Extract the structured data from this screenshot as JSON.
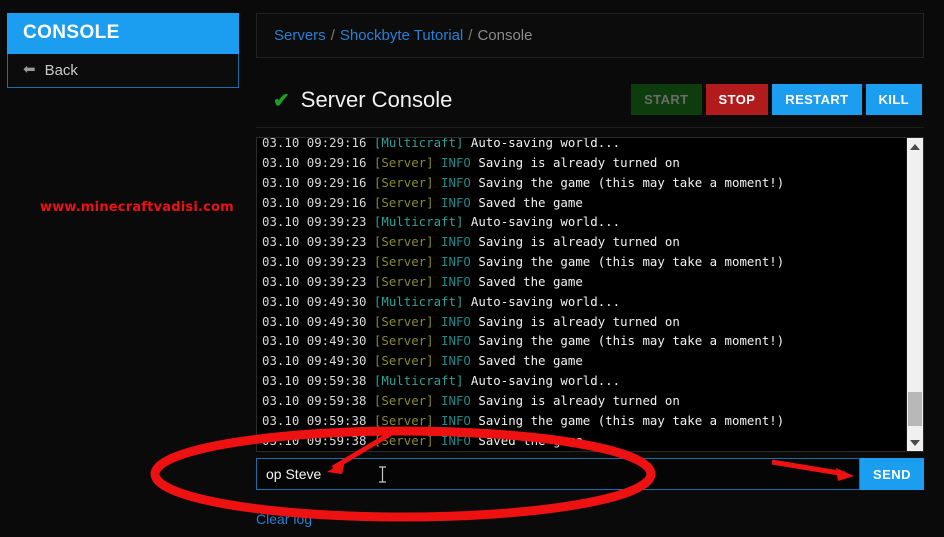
{
  "sidebar": {
    "header_label": "CONSOLE",
    "back_label": "Back",
    "back_icon": "arrow-left-icon"
  },
  "watermark": {
    "text": "www.minecraftvadisi.com",
    "color": "#ee1111"
  },
  "breadcrumb": {
    "items": [
      {
        "label": "Servers",
        "type": "link"
      },
      {
        "label": "Shockbyte Tutorial",
        "type": "link"
      },
      {
        "label": "Console",
        "type": "current"
      }
    ],
    "separator": "/"
  },
  "header": {
    "status_icon": "check-icon",
    "status_color": "#1f9c28",
    "title": "Server Console"
  },
  "controls": {
    "buttons": [
      {
        "label": "START",
        "state": "disabled",
        "color": "#0d3d0d"
      },
      {
        "label": "STOP",
        "state": "enabled",
        "color": "#b21b1b"
      },
      {
        "label": "RESTART",
        "state": "enabled",
        "color": "#1b9df0"
      },
      {
        "label": "KILL",
        "state": "enabled",
        "color": "#1b9df0"
      }
    ]
  },
  "console": {
    "lines": [
      {
        "ts": "03.10 09:29:16",
        "tag": "[Multicraft]",
        "tag_type": "multicraft",
        "level": "",
        "msg": "Auto-saving world..."
      },
      {
        "ts": "03.10 09:29:16",
        "tag": "[Server]",
        "tag_type": "server",
        "level": "INFO",
        "msg": "Saving is already turned on"
      },
      {
        "ts": "03.10 09:29:16",
        "tag": "[Server]",
        "tag_type": "server",
        "level": "INFO",
        "msg": "Saving the game (this may take a moment!)"
      },
      {
        "ts": "03.10 09:29:16",
        "tag": "[Server]",
        "tag_type": "server",
        "level": "INFO",
        "msg": "Saved the game"
      },
      {
        "ts": "03.10 09:39:23",
        "tag": "[Multicraft]",
        "tag_type": "multicraft",
        "level": "",
        "msg": "Auto-saving world..."
      },
      {
        "ts": "03.10 09:39:23",
        "tag": "[Server]",
        "tag_type": "server",
        "level": "INFO",
        "msg": "Saving is already turned on"
      },
      {
        "ts": "03.10 09:39:23",
        "tag": "[Server]",
        "tag_type": "server",
        "level": "INFO",
        "msg": "Saving the game (this may take a moment!)"
      },
      {
        "ts": "03.10 09:39:23",
        "tag": "[Server]",
        "tag_type": "server",
        "level": "INFO",
        "msg": "Saved the game"
      },
      {
        "ts": "03.10 09:49:30",
        "tag": "[Multicraft]",
        "tag_type": "multicraft",
        "level": "",
        "msg": "Auto-saving world..."
      },
      {
        "ts": "03.10 09:49:30",
        "tag": "[Server]",
        "tag_type": "server",
        "level": "INFO",
        "msg": "Saving is already turned on"
      },
      {
        "ts": "03.10 09:49:30",
        "tag": "[Server]",
        "tag_type": "server",
        "level": "INFO",
        "msg": "Saving the game (this may take a moment!)"
      },
      {
        "ts": "03.10 09:49:30",
        "tag": "[Server]",
        "tag_type": "server",
        "level": "INFO",
        "msg": "Saved the game"
      },
      {
        "ts": "03.10 09:59:38",
        "tag": "[Multicraft]",
        "tag_type": "multicraft",
        "level": "",
        "msg": "Auto-saving world..."
      },
      {
        "ts": "03.10 09:59:38",
        "tag": "[Server]",
        "tag_type": "server",
        "level": "INFO",
        "msg": "Saving is already turned on"
      },
      {
        "ts": "03.10 09:59:38",
        "tag": "[Server]",
        "tag_type": "server",
        "level": "INFO",
        "msg": "Saving the game (this may take a moment!)"
      },
      {
        "ts": "03.10 09:59:38",
        "tag": "[Server]",
        "tag_type": "server",
        "level": "INFO",
        "msg": "Saved the game"
      }
    ],
    "scrollbar": {
      "up_icon": "triangle-up-icon",
      "down_icon": "triangle-down-icon",
      "position": "near-bottom"
    }
  },
  "command": {
    "value": "op Steve",
    "placeholder": "",
    "send_label": "SEND",
    "cursor_icon": "text-caret-icon"
  },
  "footer": {
    "clear_log_label": "Clear log"
  },
  "annotations": {
    "ellipse": {
      "color": "#ee1111",
      "target": "command-input"
    },
    "arrow_to_input": {
      "color": "#ee1111"
    },
    "arrow_to_send": {
      "color": "#ee1111"
    }
  }
}
